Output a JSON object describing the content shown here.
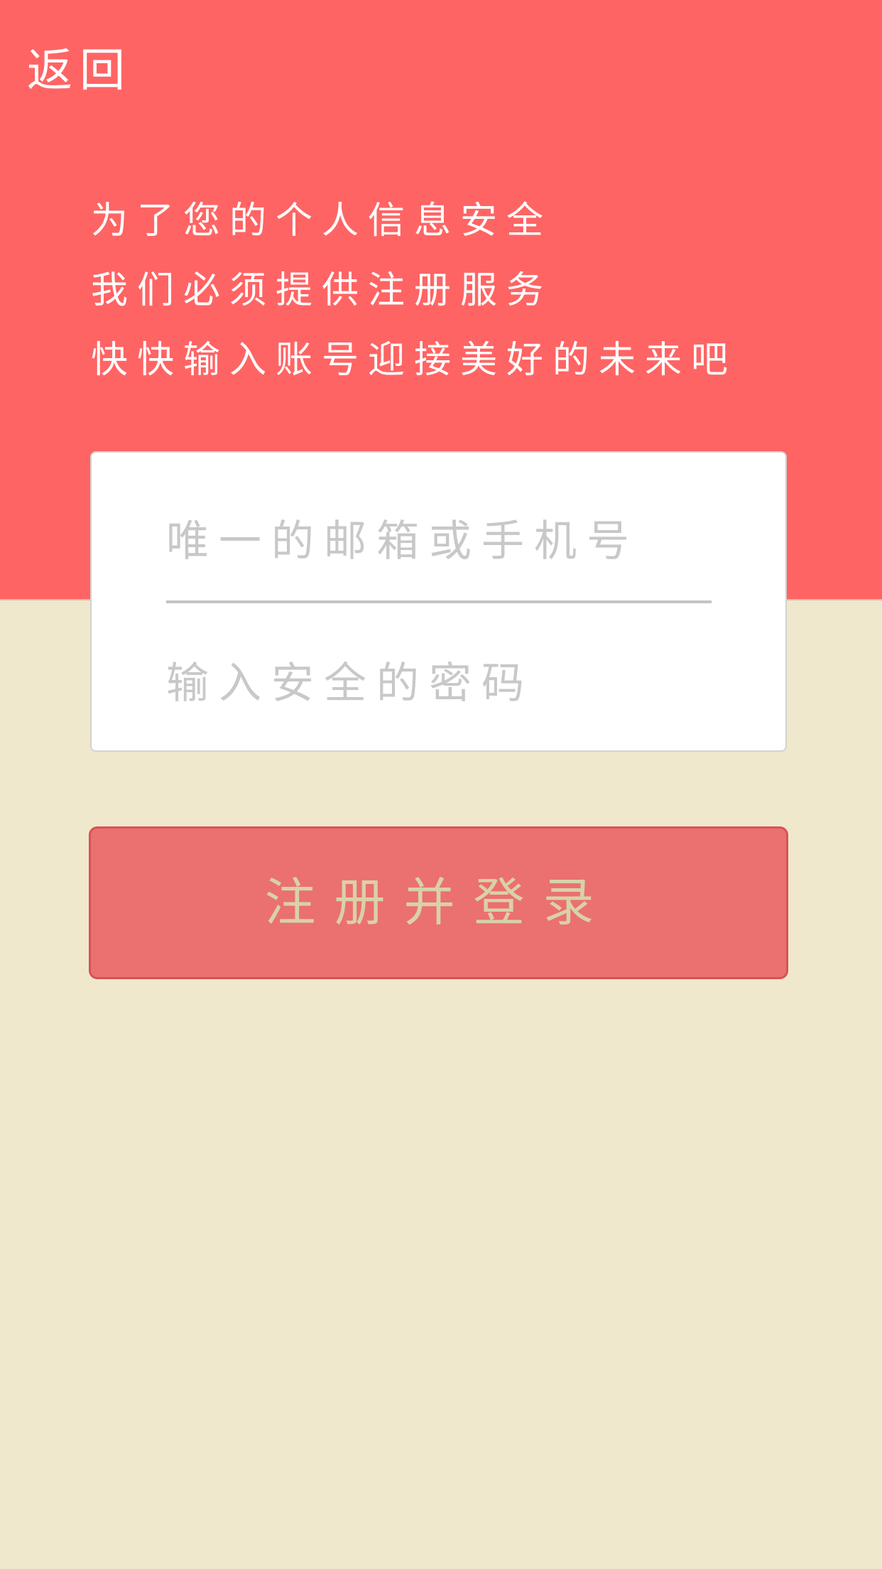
{
  "header": {
    "back_label": "返回"
  },
  "intro": {
    "lines": [
      "为了您的个人信息安全",
      "我们必须提供注册服务",
      "快快输入账号迎接美好的未来吧"
    ]
  },
  "form": {
    "account": {
      "value": "",
      "placeholder": "唯一的邮箱或手机号"
    },
    "password": {
      "value": "",
      "placeholder": "输入安全的密码"
    },
    "submit_label": "注册并登录"
  },
  "colors": {
    "header_background": "#FF6464",
    "page_background": "#EFE8CC",
    "button_background": "#EB7070",
    "button_text": "#D8D2A6",
    "placeholder_text": "#C8C8C8"
  }
}
